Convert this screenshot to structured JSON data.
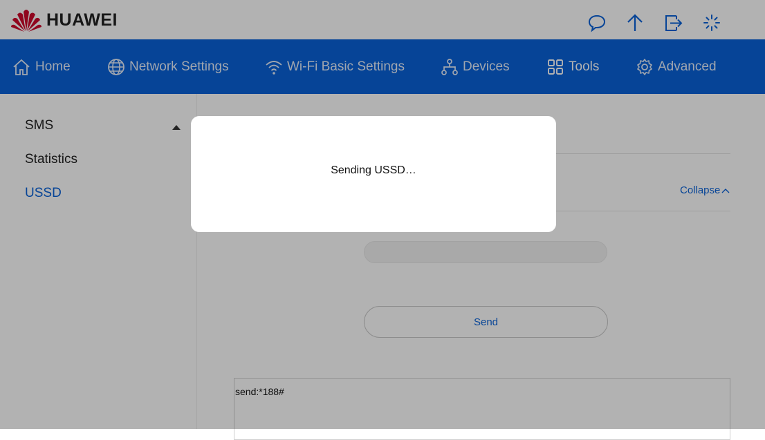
{
  "header": {
    "brand": "HUAWEI",
    "icons": [
      "message-icon",
      "upload-arrow-icon",
      "logout-icon",
      "loading-spinner-icon"
    ]
  },
  "nav": {
    "items": [
      {
        "label": "Home",
        "icon": "home-icon"
      },
      {
        "label": "Network Settings",
        "icon": "globe-icon"
      },
      {
        "label": "Wi-Fi Basic Settings",
        "icon": "wifi-icon"
      },
      {
        "label": "Devices",
        "icon": "devices-icon"
      },
      {
        "label": "Tools",
        "icon": "tools-grid-icon",
        "active": true
      },
      {
        "label": "Advanced",
        "icon": "gear-icon"
      }
    ]
  },
  "sidebar": {
    "items": [
      {
        "label": "SMS"
      },
      {
        "label": "Statistics"
      },
      {
        "label": "USSD",
        "active": true
      }
    ]
  },
  "main": {
    "collapse_label": "Collapse",
    "ussd_input_value": "",
    "send_label": "Send",
    "result_text": "send:*188#"
  },
  "modal": {
    "message": "Sending USSD…"
  },
  "colors": {
    "brand_blue": "#0a62d8",
    "huawei_red": "#cf0a2c"
  }
}
